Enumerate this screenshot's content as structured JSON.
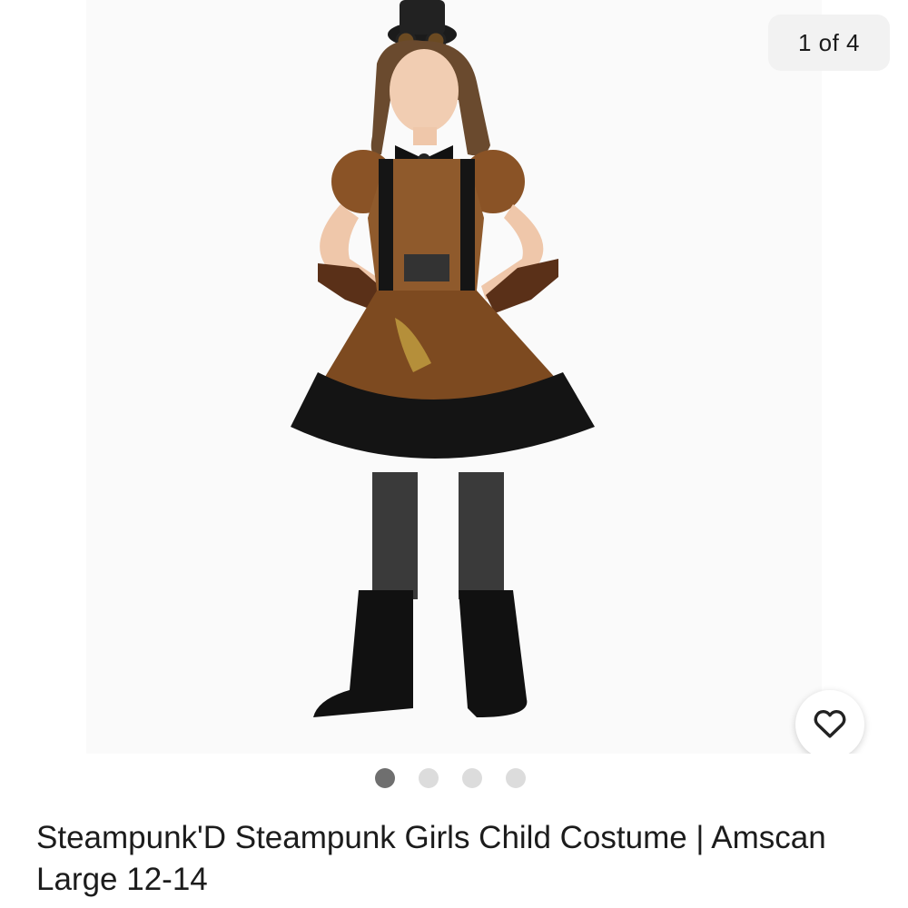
{
  "gallery": {
    "counter_text": "1 of 4",
    "current_index": 1,
    "total_images": 4,
    "image_alt": "Steampunk'D Steampunk Girls Child Costume"
  },
  "favorite": {
    "icon": "heart-outline-icon",
    "active": false
  },
  "product": {
    "title": "Steampunk'D Steampunk Girls Child Costume | Amscan Large 12-14"
  },
  "colors": {
    "active_dot": "#6f6f6f",
    "inactive_dot": "#dcdcdc",
    "counter_bg": "#f2f2f2"
  }
}
